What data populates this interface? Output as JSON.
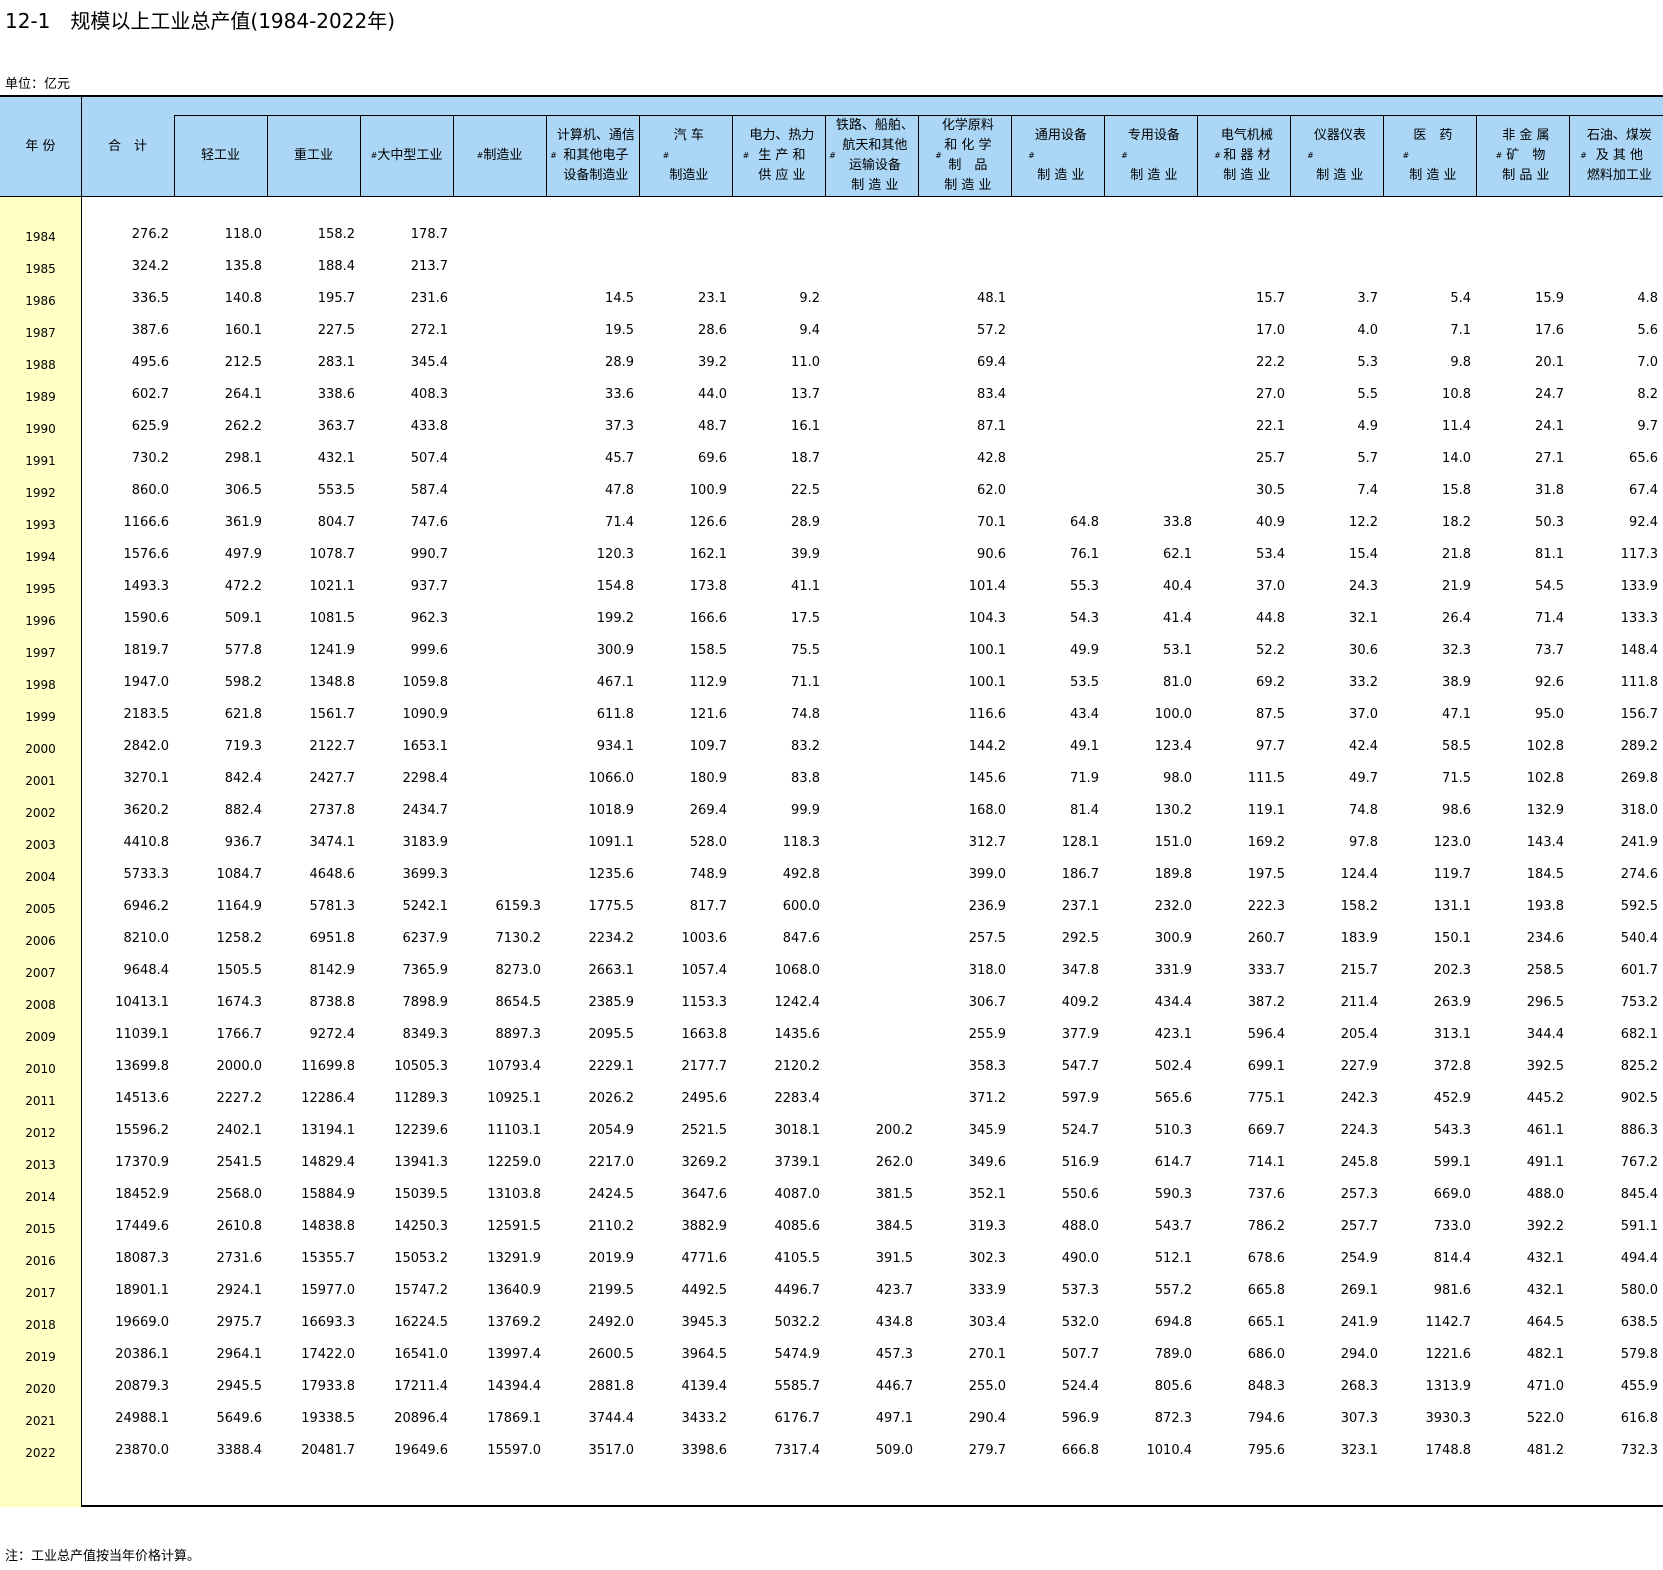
{
  "title": "12-1　规模以上工业总产值(1984-2022年)",
  "unit": "单位：亿元",
  "note": "注：工业总产值按当年价格计算。",
  "columns": [
    {
      "label": "年 份",
      "mark": ""
    },
    {
      "label": "合　计",
      "mark": ""
    },
    {
      "label": "轻工业",
      "mark": ""
    },
    {
      "label": "重工业",
      "mark": ""
    },
    {
      "label": "大中型工业",
      "mark": "#"
    },
    {
      "label": "制造业",
      "mark": "#"
    },
    {
      "label": "计算机、通信\n和其他电子\n设备制造业",
      "mark": "#"
    },
    {
      "label": "汽 车\n\n制造业",
      "mark": "#"
    },
    {
      "label": "电力、热力\n生 产 和\n供 应 业",
      "mark": "#"
    },
    {
      "label": "铁路、船舶、\n航天和其他\n运输设备\n制 造 业",
      "mark": "#"
    },
    {
      "label": "化学原料\n和 化 学\n制　品\n制 造 业",
      "mark": "#"
    },
    {
      "label": "通用设备\n\n制 造 业",
      "mark": "#"
    },
    {
      "label": "专用设备\n\n制 造 业",
      "mark": "#"
    },
    {
      "label": "电气机械\n和 器 材\n制 造 业",
      "mark": "#"
    },
    {
      "label": "仪器仪表\n\n制 造 业",
      "mark": "#"
    },
    {
      "label": "医　药\n\n制 造 业",
      "mark": "#"
    },
    {
      "label": "非 金 属\n矿　物\n制 品 业",
      "mark": "#"
    },
    {
      "label": "石油、煤炭\n及 其 他\n燃料加工业",
      "mark": "#"
    }
  ],
  "rows": [
    [
      "1984",
      "276.2",
      "118.0",
      "158.2",
      "178.7",
      "",
      "",
      "",
      "",
      "",
      "",
      "",
      "",
      "",
      "",
      "",
      "",
      ""
    ],
    [
      "1985",
      "324.2",
      "135.8",
      "188.4",
      "213.7",
      "",
      "",
      "",
      "",
      "",
      "",
      "",
      "",
      "",
      "",
      "",
      "",
      ""
    ],
    [
      "1986",
      "336.5",
      "140.8",
      "195.7",
      "231.6",
      "",
      "14.5",
      "23.1",
      "9.2",
      "",
      "48.1",
      "",
      "",
      "15.7",
      "3.7",
      "5.4",
      "15.9",
      "4.8"
    ],
    [
      "1987",
      "387.6",
      "160.1",
      "227.5",
      "272.1",
      "",
      "19.5",
      "28.6",
      "9.4",
      "",
      "57.2",
      "",
      "",
      "17.0",
      "4.0",
      "7.1",
      "17.6",
      "5.6"
    ],
    [
      "1988",
      "495.6",
      "212.5",
      "283.1",
      "345.4",
      "",
      "28.9",
      "39.2",
      "11.0",
      "",
      "69.4",
      "",
      "",
      "22.2",
      "5.3",
      "9.8",
      "20.1",
      "7.0"
    ],
    [
      "1989",
      "602.7",
      "264.1",
      "338.6",
      "408.3",
      "",
      "33.6",
      "44.0",
      "13.7",
      "",
      "83.4",
      "",
      "",
      "27.0",
      "5.5",
      "10.8",
      "24.7",
      "8.2"
    ],
    [
      "1990",
      "625.9",
      "262.2",
      "363.7",
      "433.8",
      "",
      "37.3",
      "48.7",
      "16.1",
      "",
      "87.1",
      "",
      "",
      "22.1",
      "4.9",
      "11.4",
      "24.1",
      "9.7"
    ],
    [
      "1991",
      "730.2",
      "298.1",
      "432.1",
      "507.4",
      "",
      "45.7",
      "69.6",
      "18.7",
      "",
      "42.8",
      "",
      "",
      "25.7",
      "5.7",
      "14.0",
      "27.1",
      "65.6"
    ],
    [
      "1992",
      "860.0",
      "306.5",
      "553.5",
      "587.4",
      "",
      "47.8",
      "100.9",
      "22.5",
      "",
      "62.0",
      "",
      "",
      "30.5",
      "7.4",
      "15.8",
      "31.8",
      "67.4"
    ],
    [
      "1993",
      "1166.6",
      "361.9",
      "804.7",
      "747.6",
      "",
      "71.4",
      "126.6",
      "28.9",
      "",
      "70.1",
      "64.8",
      "33.8",
      "40.9",
      "12.2",
      "18.2",
      "50.3",
      "92.4"
    ],
    [
      "1994",
      "1576.6",
      "497.9",
      "1078.7",
      "990.7",
      "",
      "120.3",
      "162.1",
      "39.9",
      "",
      "90.6",
      "76.1",
      "62.1",
      "53.4",
      "15.4",
      "21.8",
      "81.1",
      "117.3"
    ],
    [
      "1995",
      "1493.3",
      "472.2",
      "1021.1",
      "937.7",
      "",
      "154.8",
      "173.8",
      "41.1",
      "",
      "101.4",
      "55.3",
      "40.4",
      "37.0",
      "24.3",
      "21.9",
      "54.5",
      "133.9"
    ],
    [
      "1996",
      "1590.6",
      "509.1",
      "1081.5",
      "962.3",
      "",
      "199.2",
      "166.6",
      "17.5",
      "",
      "104.3",
      "54.3",
      "41.4",
      "44.8",
      "32.1",
      "26.4",
      "71.4",
      "133.3"
    ],
    [
      "1997",
      "1819.7",
      "577.8",
      "1241.9",
      "999.6",
      "",
      "300.9",
      "158.5",
      "75.5",
      "",
      "100.1",
      "49.9",
      "53.1",
      "52.2",
      "30.6",
      "32.3",
      "73.7",
      "148.4"
    ],
    [
      "1998",
      "1947.0",
      "598.2",
      "1348.8",
      "1059.8",
      "",
      "467.1",
      "112.9",
      "71.1",
      "",
      "100.1",
      "53.5",
      "81.0",
      "69.2",
      "33.2",
      "38.9",
      "92.6",
      "111.8"
    ],
    [
      "1999",
      "2183.5",
      "621.8",
      "1561.7",
      "1090.9",
      "",
      "611.8",
      "121.6",
      "74.8",
      "",
      "116.6",
      "43.4",
      "100.0",
      "87.5",
      "37.0",
      "47.1",
      "95.0",
      "156.7"
    ],
    [
      "2000",
      "2842.0",
      "719.3",
      "2122.7",
      "1653.1",
      "",
      "934.1",
      "109.7",
      "83.2",
      "",
      "144.2",
      "49.1",
      "123.4",
      "97.7",
      "42.4",
      "58.5",
      "102.8",
      "289.2"
    ],
    [
      "2001",
      "3270.1",
      "842.4",
      "2427.7",
      "2298.4",
      "",
      "1066.0",
      "180.9",
      "83.8",
      "",
      "145.6",
      "71.9",
      "98.0",
      "111.5",
      "49.7",
      "71.5",
      "102.8",
      "269.8"
    ],
    [
      "2002",
      "3620.2",
      "882.4",
      "2737.8",
      "2434.7",
      "",
      "1018.9",
      "269.4",
      "99.9",
      "",
      "168.0",
      "81.4",
      "130.2",
      "119.1",
      "74.8",
      "98.6",
      "132.9",
      "318.0"
    ],
    [
      "2003",
      "4410.8",
      "936.7",
      "3474.1",
      "3183.9",
      "",
      "1091.1",
      "528.0",
      "118.3",
      "",
      "312.7",
      "128.1",
      "151.0",
      "169.2",
      "97.8",
      "123.0",
      "143.4",
      "241.9"
    ],
    [
      "2004",
      "5733.3",
      "1084.7",
      "4648.6",
      "3699.3",
      "",
      "1235.6",
      "748.9",
      "492.8",
      "",
      "399.0",
      "186.7",
      "189.8",
      "197.5",
      "124.4",
      "119.7",
      "184.5",
      "274.6"
    ],
    [
      "2005",
      "6946.2",
      "1164.9",
      "5781.3",
      "5242.1",
      "6159.3",
      "1775.5",
      "817.7",
      "600.0",
      "",
      "236.9",
      "237.1",
      "232.0",
      "222.3",
      "158.2",
      "131.1",
      "193.8",
      "592.5"
    ],
    [
      "2006",
      "8210.0",
      "1258.2",
      "6951.8",
      "6237.9",
      "7130.2",
      "2234.2",
      "1003.6",
      "847.6",
      "",
      "257.5",
      "292.5",
      "300.9",
      "260.7",
      "183.9",
      "150.1",
      "234.6",
      "540.4"
    ],
    [
      "2007",
      "9648.4",
      "1505.5",
      "8142.9",
      "7365.9",
      "8273.0",
      "2663.1",
      "1057.4",
      "1068.0",
      "",
      "318.0",
      "347.8",
      "331.9",
      "333.7",
      "215.7",
      "202.3",
      "258.5",
      "601.7"
    ],
    [
      "2008",
      "10413.1",
      "1674.3",
      "8738.8",
      "7898.9",
      "8654.5",
      "2385.9",
      "1153.3",
      "1242.4",
      "",
      "306.7",
      "409.2",
      "434.4",
      "387.2",
      "211.4",
      "263.9",
      "296.5",
      "753.2"
    ],
    [
      "2009",
      "11039.1",
      "1766.7",
      "9272.4",
      "8349.3",
      "8897.3",
      "2095.5",
      "1663.8",
      "1435.6",
      "",
      "255.9",
      "377.9",
      "423.1",
      "596.4",
      "205.4",
      "313.1",
      "344.4",
      "682.1"
    ],
    [
      "2010",
      "13699.8",
      "2000.0",
      "11699.8",
      "10505.3",
      "10793.4",
      "2229.1",
      "2177.7",
      "2120.2",
      "",
      "358.3",
      "547.7",
      "502.4",
      "699.1",
      "227.9",
      "372.8",
      "392.5",
      "825.2"
    ],
    [
      "2011",
      "14513.6",
      "2227.2",
      "12286.4",
      "11289.3",
      "10925.1",
      "2026.2",
      "2495.6",
      "2283.4",
      "",
      "371.2",
      "597.9",
      "565.6",
      "775.1",
      "242.3",
      "452.9",
      "445.2",
      "902.5"
    ],
    [
      "2012",
      "15596.2",
      "2402.1",
      "13194.1",
      "12239.6",
      "11103.1",
      "2054.9",
      "2521.5",
      "3018.1",
      "200.2",
      "345.9",
      "524.7",
      "510.3",
      "669.7",
      "224.3",
      "543.3",
      "461.1",
      "886.3"
    ],
    [
      "2013",
      "17370.9",
      "2541.5",
      "14829.4",
      "13941.3",
      "12259.0",
      "2217.0",
      "3269.2",
      "3739.1",
      "262.0",
      "349.6",
      "516.9",
      "614.7",
      "714.1",
      "245.8",
      "599.1",
      "491.1",
      "767.2"
    ],
    [
      "2014",
      "18452.9",
      "2568.0",
      "15884.9",
      "15039.5",
      "13103.8",
      "2424.5",
      "3647.6",
      "4087.0",
      "381.5",
      "352.1",
      "550.6",
      "590.3",
      "737.6",
      "257.3",
      "669.0",
      "488.0",
      "845.4"
    ],
    [
      "2015",
      "17449.6",
      "2610.8",
      "14838.8",
      "14250.3",
      "12591.5",
      "2110.2",
      "3882.9",
      "4085.6",
      "384.5",
      "319.3",
      "488.0",
      "543.7",
      "786.2",
      "257.7",
      "733.0",
      "392.2",
      "591.1"
    ],
    [
      "2016",
      "18087.3",
      "2731.6",
      "15355.7",
      "15053.2",
      "13291.9",
      "2019.9",
      "4771.6",
      "4105.5",
      "391.5",
      "302.3",
      "490.0",
      "512.1",
      "678.6",
      "254.9",
      "814.4",
      "432.1",
      "494.4"
    ],
    [
      "2017",
      "18901.1",
      "2924.1",
      "15977.0",
      "15747.2",
      "13640.9",
      "2199.5",
      "4492.5",
      "4496.7",
      "423.7",
      "333.9",
      "537.3",
      "557.2",
      "665.8",
      "269.1",
      "981.6",
      "432.1",
      "580.0"
    ],
    [
      "2018",
      "19669.0",
      "2975.7",
      "16693.3",
      "16224.5",
      "13769.2",
      "2492.0",
      "3945.3",
      "5032.2",
      "434.8",
      "303.4",
      "532.0",
      "694.8",
      "665.1",
      "241.9",
      "1142.7",
      "464.5",
      "638.5"
    ],
    [
      "2019",
      "20386.1",
      "2964.1",
      "17422.0",
      "16541.0",
      "13997.4",
      "2600.5",
      "3964.5",
      "5474.9",
      "457.3",
      "270.1",
      "507.7",
      "789.0",
      "686.0",
      "294.0",
      "1221.6",
      "482.1",
      "579.8"
    ],
    [
      "2020",
      "20879.3",
      "2945.5",
      "17933.8",
      "17211.4",
      "14394.4",
      "2881.8",
      "4139.4",
      "5585.7",
      "446.7",
      "255.0",
      "524.4",
      "805.6",
      "848.3",
      "268.3",
      "1313.9",
      "471.0",
      "455.9"
    ],
    [
      "2021",
      "24988.1",
      "5649.6",
      "19338.5",
      "20896.4",
      "17869.1",
      "3744.4",
      "3433.2",
      "6176.7",
      "497.1",
      "290.4",
      "596.9",
      "872.3",
      "794.6",
      "307.3",
      "3930.3",
      "522.0",
      "616.8"
    ],
    [
      "2022",
      "23870.0",
      "3388.4",
      "20481.7",
      "19649.6",
      "15597.0",
      "3517.0",
      "3398.6",
      "7317.4",
      "509.0",
      "279.7",
      "666.8",
      "1010.4",
      "795.6",
      "323.1",
      "1748.8",
      "481.2",
      "732.3"
    ]
  ]
}
